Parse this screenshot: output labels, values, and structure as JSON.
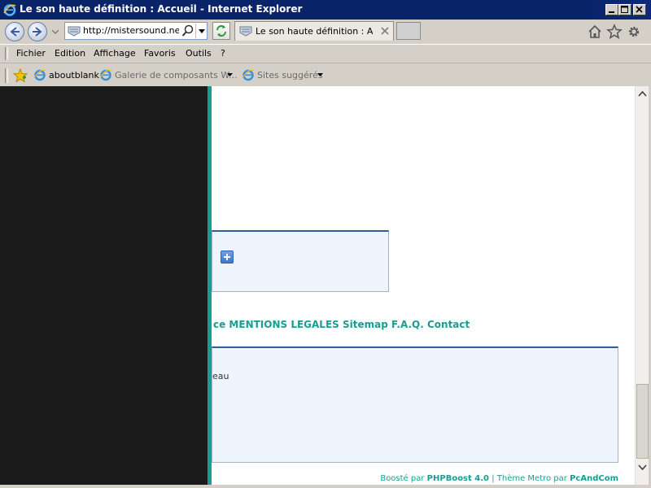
{
  "window": {
    "title": "Le son haute définition : Accueil - Internet Explorer",
    "buttons": [
      "minimize-icon",
      "maximize-icon",
      "close-icon"
    ]
  },
  "nav": {
    "back_icon": "back-arrow-icon",
    "forward_icon": "forward-arrow-icon",
    "address_value": "http://mistersound.net/|",
    "tab_title": "Le son haute définition : Acc...",
    "command_icons": [
      "home-icon",
      "favorites-star-icon",
      "tools-gear-icon"
    ]
  },
  "menubar": {
    "items": [
      "Fichier",
      "Edition",
      "Affichage",
      "Favoris",
      "Outils",
      "?"
    ]
  },
  "favorites_bar": {
    "links": [
      {
        "label": "aboutblank"
      },
      {
        "label": "Galerie de composants W..."
      },
      {
        "label": "Sites suggérés"
      }
    ]
  },
  "page": {
    "footer_links": "ce MENTIONS LEGALES Sitemap F.A.Q. Contact",
    "box2_fragment": "eau",
    "credits": {
      "boosted_by": "Boosté par",
      "engine": "PHPBoost 4.0",
      "separator": "|",
      "theme_by": "Thème Metro par",
      "author": "PcAndCom"
    }
  },
  "colors": {
    "titlebar": "#0a246a",
    "teal_accent": "#199d93",
    "dark_panel": "#1b1b1b",
    "box_border_top": "#2d5c9f",
    "box_bg": "#eff5fd"
  }
}
